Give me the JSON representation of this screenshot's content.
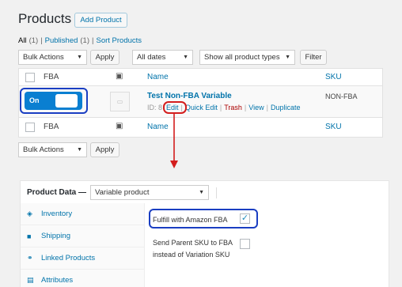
{
  "page": {
    "title": "Products",
    "add_button": "Add Product"
  },
  "filters_links": {
    "all": "All",
    "all_count": "(1)",
    "sep1": "|",
    "published": "Published",
    "published_count": "(1)",
    "sep2": "|",
    "sort": "Sort Products"
  },
  "toolbar_top": {
    "bulk_actions": "Bulk Actions",
    "apply": "Apply",
    "dates": "All dates",
    "types": "Show all product types",
    "filter": "Filter"
  },
  "table": {
    "col_fba": "FBA",
    "col_name": "Name",
    "col_sku": "SKU",
    "image_col_icon": "image-icon"
  },
  "product": {
    "toggle_label": "On",
    "name": "Test Non-FBA Variable",
    "id_label": "ID: 8",
    "actions": {
      "edit": "Edit",
      "quick_edit": "Quick Edit",
      "trash": "Trash",
      "view": "View",
      "duplicate": "Duplicate",
      "sep": "|"
    },
    "sku": "NON-FBA"
  },
  "toolbar_bottom": {
    "bulk_actions": "Bulk Actions",
    "apply": "Apply"
  },
  "product_data": {
    "label": "Product Data —",
    "type": "Variable product",
    "tabs": [
      {
        "label": "Inventory",
        "icon": "tag-icon"
      },
      {
        "label": "Shipping",
        "icon": "truck-icon"
      },
      {
        "label": "Linked Products",
        "icon": "link-icon"
      },
      {
        "label": "Attributes",
        "icon": "list-icon"
      }
    ],
    "fba_label": "Fulfill with Amazon FBA",
    "fba_checked": true,
    "parent_sku_label_1": "Send Parent SKU to FBA",
    "parent_sku_label_2": "instead of Variation SKU",
    "parent_sku_checked": false
  },
  "colors": {
    "accent": "#0073aa",
    "highlight_blue": "#1a3ec2",
    "highlight_red": "#d31d1d"
  }
}
